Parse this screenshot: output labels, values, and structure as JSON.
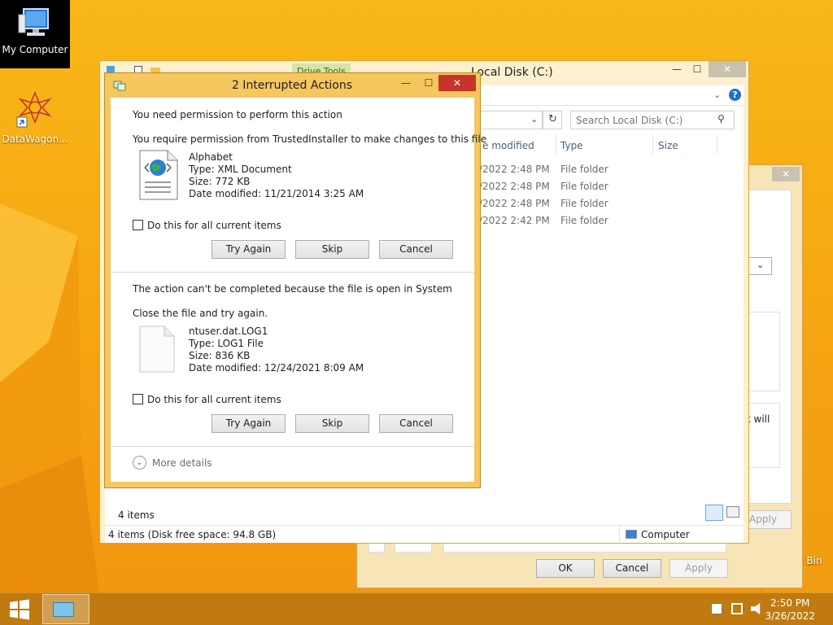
{
  "desktop": {
    "icons": {
      "my_computer": "My Computer",
      "datawagon": "DataWagon...",
      "recycle_bin": "Recycle Bin"
    }
  },
  "explorer": {
    "title": "Local Disk (C:)",
    "ribbon_tab": "Drive Tools",
    "search_placeholder": "Search Local Disk (C:)",
    "columns": [
      "Date modified",
      "Type",
      "Size"
    ],
    "column_date_visible": "e modified",
    "rows": [
      {
        "date": "/2022 2:48 PM",
        "type": "File folder"
      },
      {
        "date": "/2022 2:48 PM",
        "type": "File folder"
      },
      {
        "date": "/2022 2:48 PM",
        "type": "File folder"
      },
      {
        "date": "/2022 2:42 PM",
        "type": "File folder"
      }
    ],
    "item_count": "4 items",
    "status_left": "4 items (Disk free space: 94.8 GB)",
    "status_right": "Computer"
  },
  "properties": {
    "partial_text": "t will",
    "apply_back": "Apply",
    "ok": "OK",
    "cancel": "Cancel",
    "apply": "Apply"
  },
  "dialog": {
    "title": "2 Interrupted Actions",
    "section1": {
      "heading": "You need permission to perform this action",
      "message": "You require permission from TrustedInstaller to make changes to this file",
      "file_name": "Alphabet",
      "file_type": "Type: XML Document",
      "file_size": "Size: 772 KB",
      "file_date": "Date modified: 11/21/2014 3:25 AM",
      "checkbox_label": "Do this for all current items",
      "try_again": "Try Again",
      "skip": "Skip",
      "cancel": "Cancel"
    },
    "section2": {
      "heading": "The action can't be completed because the file is open in System",
      "message": "Close the file and try again.",
      "file_name": "ntuser.dat.LOG1",
      "file_type": "Type: LOG1 File",
      "file_size": "Size: 836 KB",
      "file_date": "Date modified: 12/24/2021 8:09 AM",
      "checkbox_label": "Do this for all current items",
      "try_again": "Try Again",
      "skip": "Skip",
      "cancel": "Cancel"
    },
    "more_details": "More details"
  },
  "taskbar": {
    "time": "2:50 PM",
    "date": "3/26/2022"
  },
  "colors": {
    "desktop": "#f6a712",
    "dialog_frame": "#f6c65f",
    "close_button": "#c7352a",
    "taskbar": "#c07a0f"
  }
}
